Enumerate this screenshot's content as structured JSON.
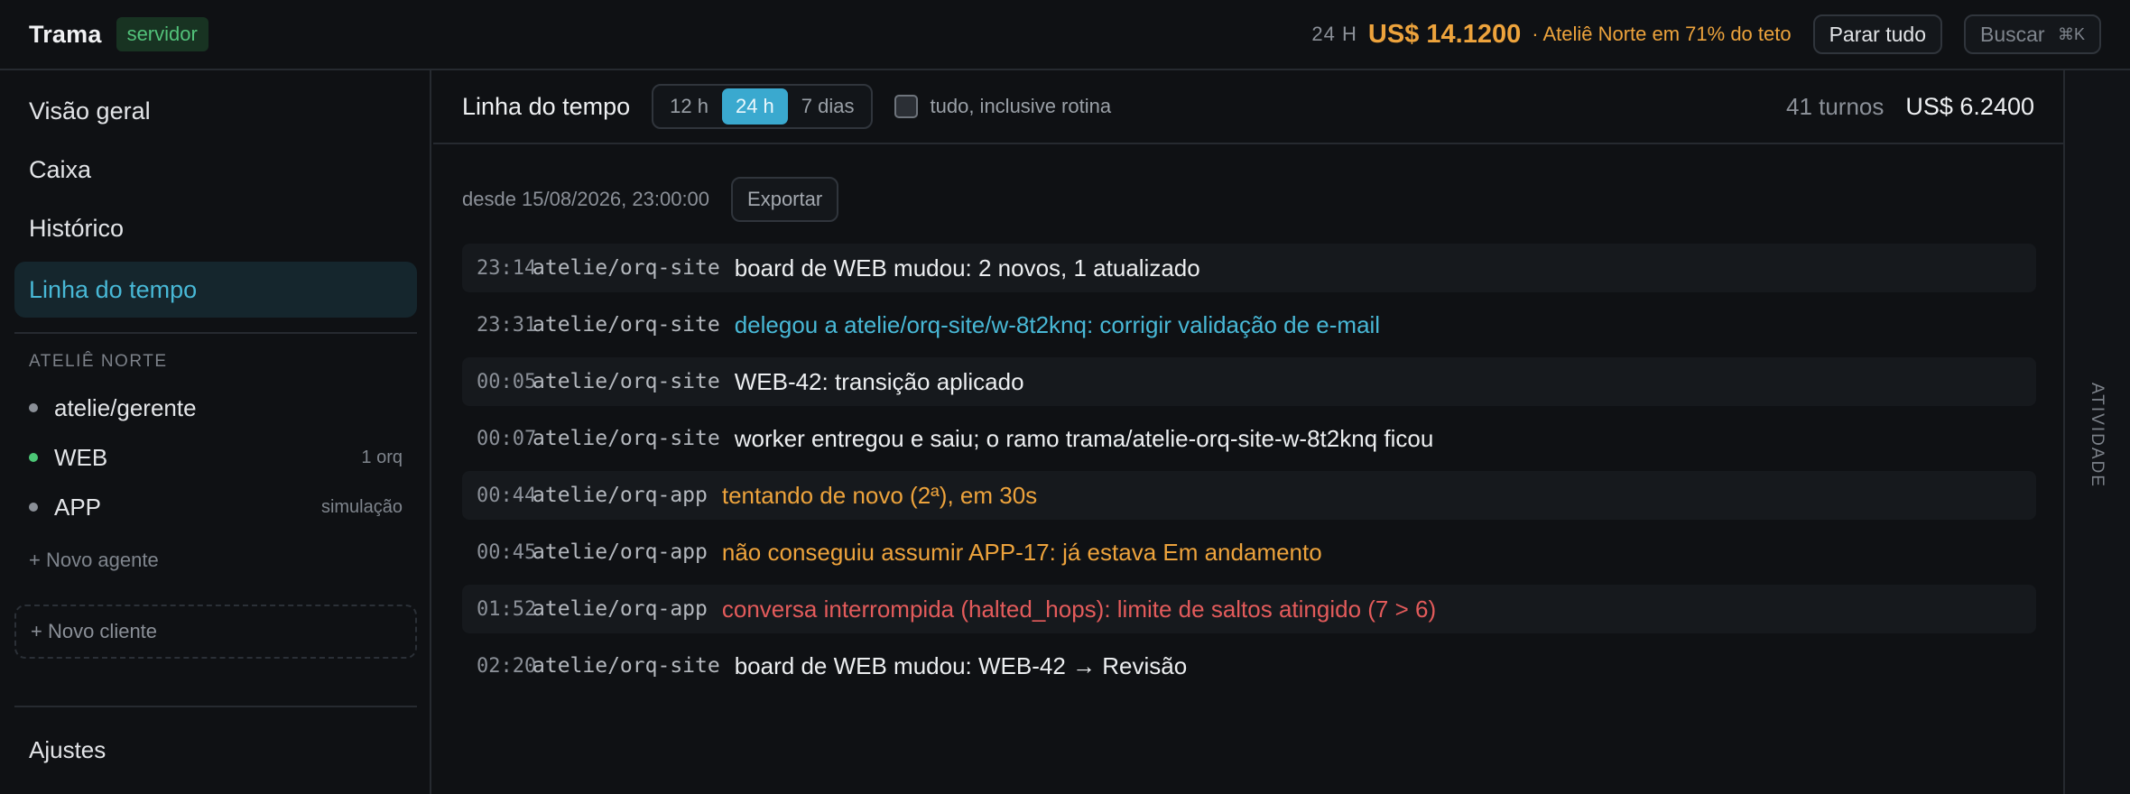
{
  "topbar": {
    "brand": "Trama",
    "env_badge": "servidor",
    "period": "24 H",
    "cost": "US$ 14.1200",
    "budget_note": "· Ateliê Norte em 71% do teto",
    "stop_all": "Parar tudo",
    "search_label": "Buscar",
    "search_shortcut": "⌘K"
  },
  "sidebar": {
    "nav": [
      "Visão geral",
      "Caixa",
      "Histórico",
      "Linha do tempo"
    ],
    "active_nav": "Linha do tempo",
    "client_label": "ATELIÊ NORTE",
    "agents": [
      {
        "name": "atelie/gerente",
        "meta": "",
        "status_color": "#8b9098"
      },
      {
        "name": "WEB",
        "meta": "1 orq",
        "status_color": "#4cc776"
      },
      {
        "name": "APP",
        "meta": "simulação",
        "status_color": "#8b9098"
      }
    ],
    "new_agent": "+ Novo agente",
    "new_client": "+ Novo cliente",
    "settings": "Ajustes"
  },
  "main": {
    "title": "Linha do tempo",
    "ranges": [
      "12 h",
      "24 h",
      "7 dias"
    ],
    "active_range": "24 h",
    "include_routine_label": "tudo, inclusive rotina",
    "include_routine_checked": false,
    "turns": "41 turnos",
    "total": "US$ 6.2400",
    "since": "desde 15/08/2026, 23:00:00",
    "export": "Exportar",
    "events": [
      {
        "time": "23:14",
        "source": "atelie/orq-site",
        "message": "board de WEB mudou: 2 novos, 1 atualizado",
        "kind": "normal"
      },
      {
        "time": "23:31",
        "source": "atelie/orq-site",
        "message": "delegou a atelie/orq-site/w-8t2knq: corrigir validação de e-mail",
        "kind": "link"
      },
      {
        "time": "00:05",
        "source": "atelie/orq-site",
        "message": "WEB-42: transição aplicado",
        "kind": "normal"
      },
      {
        "time": "00:07",
        "source": "atelie/orq-site",
        "message": "worker entregou e saiu; o ramo trama/atelie-orq-site-w-8t2knq ficou",
        "kind": "normal"
      },
      {
        "time": "00:44",
        "source": "atelie/orq-app",
        "message": "tentando de novo (2ª), em 30s",
        "kind": "warn"
      },
      {
        "time": "00:45",
        "source": "atelie/orq-app",
        "message": "não conseguiu assumir APP-17: já estava Em andamento",
        "kind": "warn"
      },
      {
        "time": "01:52",
        "source": "atelie/orq-app",
        "message": "conversa interrompida (halted_hops): limite de saltos atingido (7 > 6)",
        "kind": "err"
      },
      {
        "time": "02:20",
        "source": "atelie/orq-site",
        "message": "board de WEB mudou: WEB-42 → Revisão",
        "kind": "normal"
      }
    ]
  },
  "rail": {
    "label": "ATIVIDADE"
  },
  "colors": {
    "accent": "#3aa9cf",
    "warn": "#eda33c",
    "error": "#e35b5b",
    "ok": "#4cc776"
  }
}
